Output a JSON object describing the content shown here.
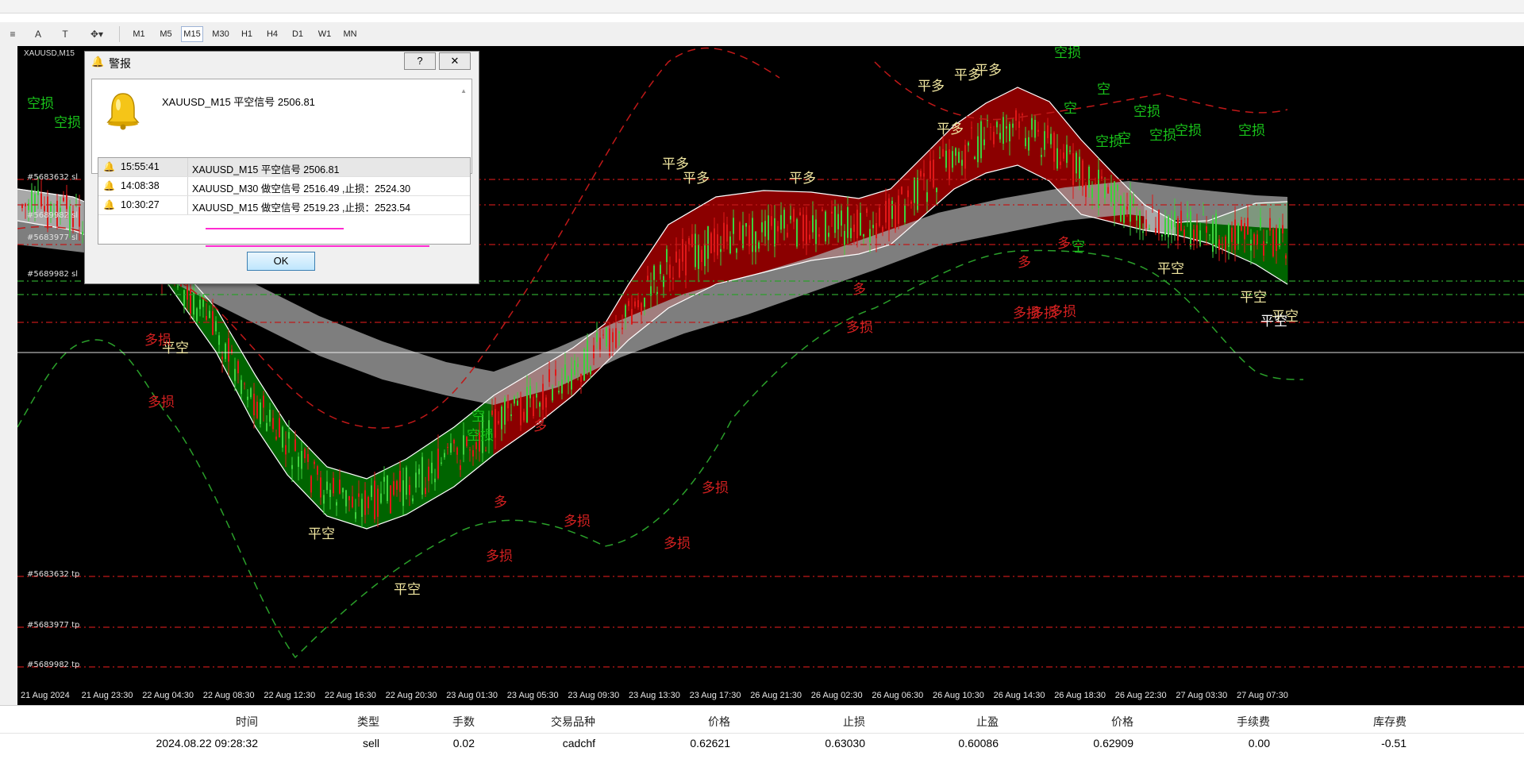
{
  "toolbar": {
    "timeframes": [
      "M1",
      "M5",
      "M15",
      "M30",
      "H1",
      "H4",
      "D1",
      "W1",
      "MN"
    ],
    "active_timeframe": "M15"
  },
  "chart": {
    "symbol_label": "XAUUSD,M15",
    "signals": [
      {
        "text": "空损",
        "color": "g"
      },
      {
        "text": "空损",
        "color": "g"
      },
      {
        "text": "空损",
        "color": "g"
      },
      {
        "text": "空",
        "color": "g"
      },
      {
        "text": "空",
        "color": "g"
      },
      {
        "text": "空损",
        "color": "g"
      },
      {
        "text": "空",
        "color": "g"
      },
      {
        "text": "空损",
        "color": "g"
      },
      {
        "text": "空损",
        "color": "g"
      },
      {
        "text": "空",
        "color": "g"
      },
      {
        "text": "空损",
        "color": "g"
      },
      {
        "text": "空损",
        "color": "g"
      },
      {
        "text": "空损",
        "color": "g"
      },
      {
        "text": "空",
        "color": "g"
      },
      {
        "text": "平多",
        "color": "y"
      },
      {
        "text": "平多",
        "color": "y"
      },
      {
        "text": "平多",
        "color": "y"
      },
      {
        "text": "平多",
        "color": "y"
      },
      {
        "text": "平多",
        "color": "y"
      },
      {
        "text": "平多",
        "color": "y"
      },
      {
        "text": "平多",
        "color": "y"
      },
      {
        "text": "平空",
        "color": "y"
      },
      {
        "text": "平空",
        "color": "y"
      },
      {
        "text": "平空",
        "color": "y"
      },
      {
        "text": "平空",
        "color": "y"
      },
      {
        "text": "平空",
        "color": "y"
      },
      {
        "text": "平空",
        "color": "y"
      },
      {
        "text": "平空",
        "color": "w"
      },
      {
        "text": "多损",
        "color": "r"
      },
      {
        "text": "多损",
        "color": "r"
      },
      {
        "text": "多损",
        "color": "r"
      },
      {
        "text": "多损",
        "color": "r"
      },
      {
        "text": "多损",
        "color": "r"
      },
      {
        "text": "多损",
        "color": "r"
      },
      {
        "text": "多损",
        "color": "r"
      },
      {
        "text": "多损",
        "color": "r"
      },
      {
        "text": "多损",
        "color": "r"
      },
      {
        "text": "多损",
        "color": "r"
      },
      {
        "text": "多",
        "color": "r"
      },
      {
        "text": "多",
        "color": "r"
      },
      {
        "text": "多",
        "color": "r"
      },
      {
        "text": "多",
        "color": "r"
      },
      {
        "text": "多",
        "color": "r"
      }
    ],
    "level_labels": [
      "#5683632 sl",
      "#5689982 sl",
      "#5683977 sl",
      "#5689982 sl",
      "#5683632 tp",
      "#5683977 tp",
      "#5689982 tp"
    ],
    "time_axis": [
      "21 Aug 2024",
      "21 Aug 23:30",
      "22 Aug 04:30",
      "22 Aug 08:30",
      "22 Aug 12:30",
      "22 Aug 16:30",
      "22 Aug 20:30",
      "23 Aug 01:30",
      "23 Aug 05:30",
      "23 Aug 09:30",
      "23 Aug 13:30",
      "23 Aug 17:30",
      "26 Aug 21:30",
      "26 Aug 02:30",
      "26 Aug 06:30",
      "26 Aug 10:30",
      "26 Aug 14:30",
      "26 Aug 18:30",
      "26 Aug 22:30",
      "27 Aug 03:30",
      "27 Aug 07:30"
    ],
    "colors": {
      "sell_band": "#8b0000",
      "buy_band": "#006400",
      "neutral_band": "#a8a8a8",
      "dash_red": "#c01818",
      "dash_green": "#2aa02a"
    }
  },
  "alert": {
    "title": "警报",
    "help_button": "?",
    "close_button": "✕",
    "message": "XAUUSD_M15 平空信号 2506.81",
    "list": [
      {
        "time": "15:55:41",
        "msg": "XAUUSD_M15 平空信号 2506.81"
      },
      {
        "time": "14:08:38",
        "msg": "XAUUSD_M30 做空信号 2516.49 ,止损：2524.30"
      },
      {
        "time": "10:30:27",
        "msg": "XAUUSD_M15 做空信号 2519.23 ,止损：2523.54"
      }
    ],
    "ok_label": "OK"
  },
  "table": {
    "headers": [
      "时间",
      "类型",
      "手数",
      "交易品种",
      "价格",
      "止损",
      "止盈",
      "价格",
      "手续费",
      "库存费"
    ],
    "row": [
      "2024.08.22 09:28:32",
      "sell",
      "0.02",
      "cadchf",
      "0.62621",
      "0.63030",
      "0.60086",
      "0.62909",
      "0.00",
      "-0.51"
    ]
  }
}
